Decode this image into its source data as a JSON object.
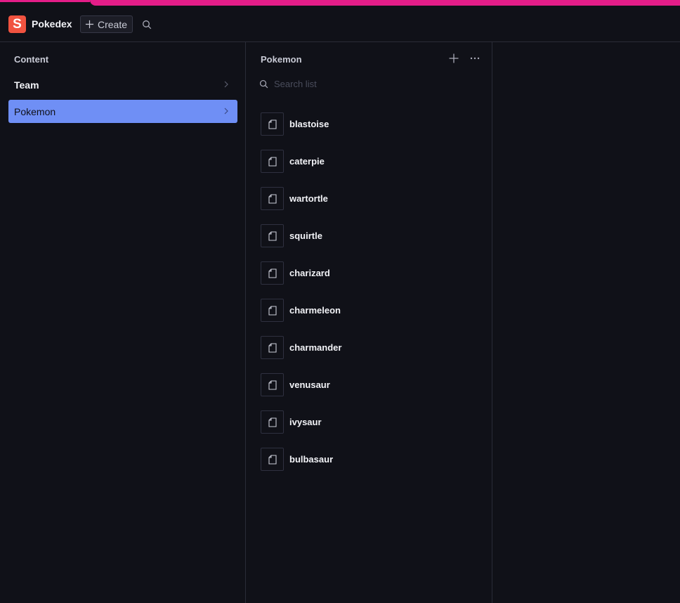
{
  "topbar": {
    "logo_letter": "S",
    "title": "Pokedex",
    "create_label": "Create"
  },
  "content_pane": {
    "title": "Content",
    "items": [
      {
        "label": "Team",
        "selected": false
      },
      {
        "label": "Pokemon",
        "selected": true
      }
    ]
  },
  "list_pane": {
    "title": "Pokemon",
    "search_placeholder": "Search list",
    "documents": [
      {
        "label": "blastoise"
      },
      {
        "label": "caterpie"
      },
      {
        "label": "wartortle"
      },
      {
        "label": "squirtle"
      },
      {
        "label": "charizard"
      },
      {
        "label": "charmeleon"
      },
      {
        "label": "charmander"
      },
      {
        "label": "venusaur"
      },
      {
        "label": "ivysaur"
      },
      {
        "label": "bulbasaur"
      }
    ]
  },
  "colors": {
    "accent": "#6f8ff5",
    "brand": "#f15340",
    "top_strip": "#e41d88",
    "background": "#101118"
  },
  "icons": [
    "plus-icon",
    "search-icon",
    "chevron-right-icon",
    "ellipsis-icon",
    "document-icon"
  ]
}
